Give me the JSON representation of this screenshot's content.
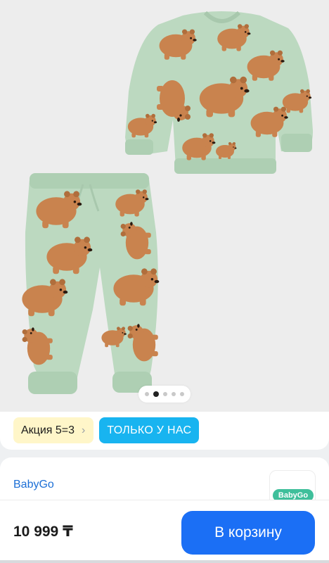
{
  "gallery": {
    "slide_count": 5,
    "active_slide": 2
  },
  "badges": {
    "promo_label": "Акция 5=3",
    "promo_chevron": "›",
    "exclusive_label": "ТОЛЬКО У НАС"
  },
  "seller": {
    "brand_name": "BabyGo",
    "logo_text": "BabyGo"
  },
  "purchase": {
    "price": "10 999 ₸",
    "cart_label": "В корзину"
  },
  "colors": {
    "accent_blue": "#1b6ff5",
    "exclusive_badge": "#18b4f0",
    "promo_badge": "#fff6c9",
    "garment_green": "#bcd9c0",
    "bear_brown": "#c9834e"
  }
}
